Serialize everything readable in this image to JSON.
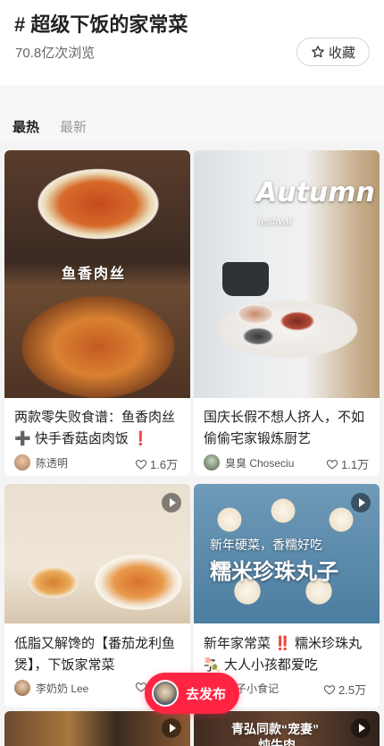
{
  "header": {
    "title": "# 超级下饭的家常菜",
    "views": "70.8亿次浏览",
    "favorite_label": "收藏"
  },
  "tabs": [
    {
      "label": "最热",
      "active": true
    },
    {
      "label": "最新",
      "active": false
    }
  ],
  "cards": [
    {
      "overlay": "鱼香肉丝",
      "desc_line1": "两款零失败食谱：鱼香肉丝",
      "desc_line2": "➕ 快手香菇卤肉饭 ❗",
      "author": "陈透明",
      "likes": "1.6万",
      "video": false
    },
    {
      "overlay_big": "Autumn",
      "overlay_small": "festival",
      "desc_line1": "国庆长假不想人挤人，不如",
      "desc_line2": "偷偷宅家锻炼厨艺",
      "author": "臭臭 Choseciu",
      "likes": "1.1万",
      "video": false
    },
    {
      "desc_line1": "低脂又解馋的【番茄龙利鱼",
      "desc_line2": "煲】，下饭家常菜",
      "author": "李奶奶 Lee",
      "likes": "",
      "video": true
    },
    {
      "overlay_small": "新年硬菜，香糯好吃",
      "overlay_big": "糯米珍珠丸子",
      "desc_line1": "新年家常菜 ‼️ 糯米珍珠丸子",
      "desc_line2": "🍡 大人小孩都爱吃",
      "author": "果子小食记",
      "likes": "2.5万",
      "video": true
    },
    {
      "video": true
    },
    {
      "overlay_top": "青弘同款“宠妻”",
      "overlay_bottom": "炖牛肉",
      "video": true
    }
  ],
  "publish_label": "去发布",
  "colors": {
    "accent": "#ff2442",
    "muted": "#999999"
  }
}
